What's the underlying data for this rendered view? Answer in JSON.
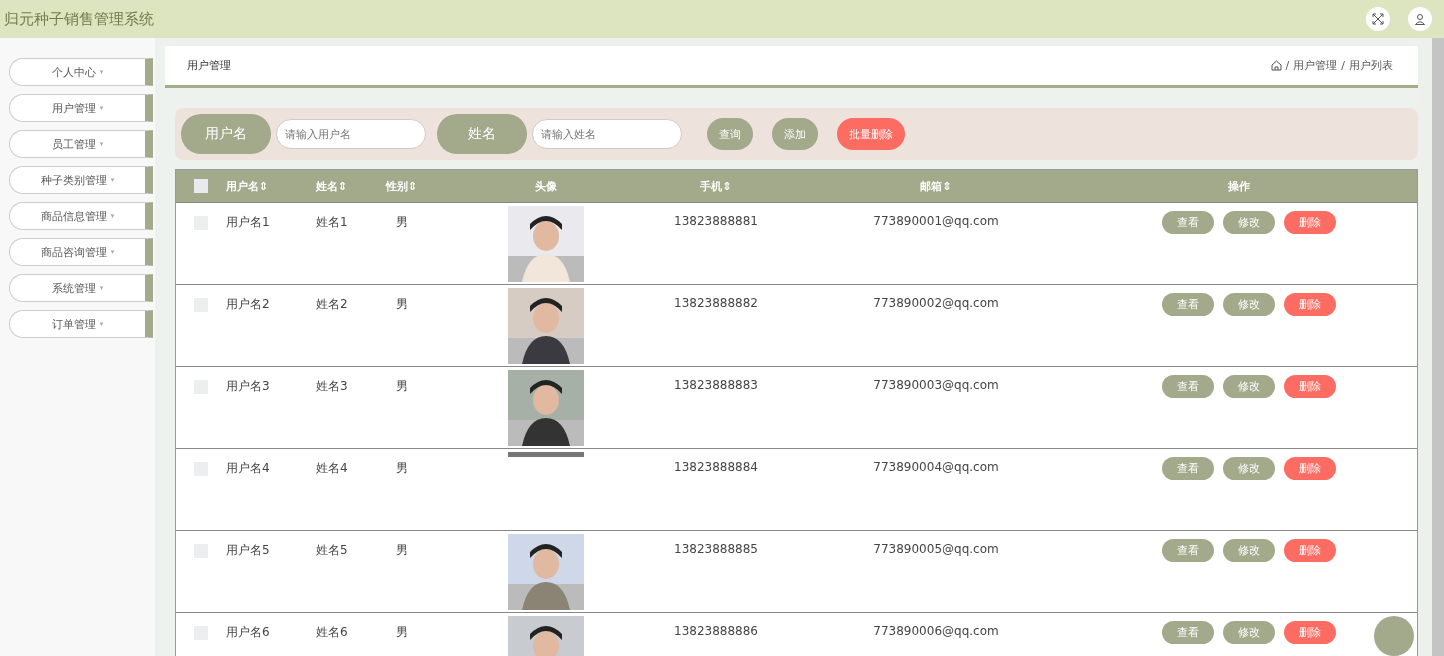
{
  "header": {
    "title": "归元种子销售管理系统"
  },
  "sidebar": {
    "items": [
      {
        "label": "个人中心",
        "caret": "▾"
      },
      {
        "label": "用户管理",
        "caret": "▾"
      },
      {
        "label": "员工管理",
        "caret": "▾"
      },
      {
        "label": "种子类别管理",
        "caret": "▾"
      },
      {
        "label": "商品信息管理",
        "caret": "▾"
      },
      {
        "label": "商品咨询管理",
        "caret": "▾"
      },
      {
        "label": "系统管理",
        "caret": "▾"
      },
      {
        "label": "订单管理",
        "caret": "▾"
      }
    ]
  },
  "page": {
    "title": "用户管理",
    "breadcrumb": [
      {
        "separator": "/",
        "label": "用户管理"
      },
      {
        "separator": "/",
        "label": "用户列表"
      }
    ]
  },
  "search": {
    "fields": [
      {
        "label": "用户名",
        "placeholder": "请输入用户名"
      },
      {
        "label": "姓名",
        "placeholder": "请输入姓名"
      }
    ],
    "buttons": [
      {
        "label": "查询",
        "kind": "normal"
      },
      {
        "label": "添加",
        "kind": "normal"
      },
      {
        "label": "批量删除",
        "kind": "danger"
      }
    ]
  },
  "table": {
    "select_all": {
      "checked": false
    },
    "columns": [
      {
        "label": "用户名",
        "sort": "⇕"
      },
      {
        "label": "姓名",
        "sort": "⇕"
      },
      {
        "label": "性别",
        "sort": "⇕"
      },
      {
        "label": "头像"
      },
      {
        "label": "手机",
        "sort": "⇕"
      },
      {
        "label": "邮箱",
        "sort": "⇕"
      },
      {
        "label": "操作"
      }
    ],
    "rows": [
      {
        "checked": false,
        "username": "用户名1",
        "name": "姓名1",
        "gender": "男",
        "has_avatar": true,
        "phone": "13823888881",
        "email": "773890001@qq.com",
        "actions": [
          "查看",
          "修改",
          "删除"
        ]
      },
      {
        "checked": false,
        "username": "用户名2",
        "name": "姓名2",
        "gender": "男",
        "has_avatar": true,
        "phone": "13823888882",
        "email": "773890002@qq.com",
        "actions": [
          "查看",
          "修改",
          "删除"
        ]
      },
      {
        "checked": false,
        "username": "用户名3",
        "name": "姓名3",
        "gender": "男",
        "has_avatar": true,
        "phone": "13823888883",
        "email": "773890003@qq.com",
        "actions": [
          "查看",
          "修改",
          "删除"
        ]
      },
      {
        "checked": false,
        "username": "用户名4",
        "name": "姓名4",
        "gender": "男",
        "has_avatar": false,
        "phone": "13823888884",
        "email": "773890004@qq.com",
        "actions": [
          "查看",
          "修改",
          "删除"
        ]
      },
      {
        "checked": false,
        "username": "用户名5",
        "name": "姓名5",
        "gender": "男",
        "has_avatar": true,
        "phone": "13823888885",
        "email": "773890005@qq.com",
        "actions": [
          "查看",
          "修改",
          "删除"
        ]
      },
      {
        "checked": false,
        "username": "用户名6",
        "name": "姓名6",
        "gender": "男",
        "has_avatar": true,
        "phone": "13823888886",
        "email": "773890006@qq.com",
        "actions": [
          "查看",
          "修改",
          "删除"
        ]
      }
    ]
  }
}
